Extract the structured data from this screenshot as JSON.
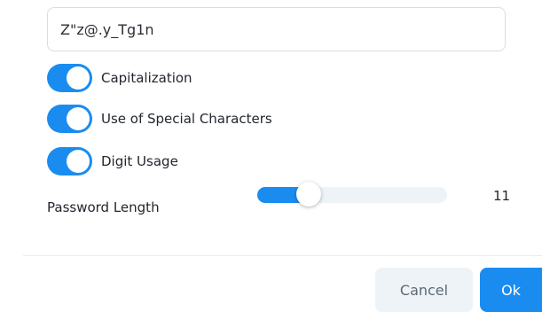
{
  "password": {
    "value": "Z\"z@.y_Tg1n"
  },
  "options": [
    {
      "label": "Capitalization",
      "enabled": true
    },
    {
      "label": "Use of Special Characters",
      "enabled": true
    },
    {
      "label": "Digit Usage",
      "enabled": true
    }
  ],
  "length": {
    "label": "Password Length",
    "value": "11",
    "fill_fraction": 0.27
  },
  "buttons": {
    "cancel": "Cancel",
    "ok": "Ok"
  },
  "colors": {
    "accent": "#1a8cf0",
    "track": "#eef3f7",
    "cancel_bg": "#eef3f7"
  }
}
